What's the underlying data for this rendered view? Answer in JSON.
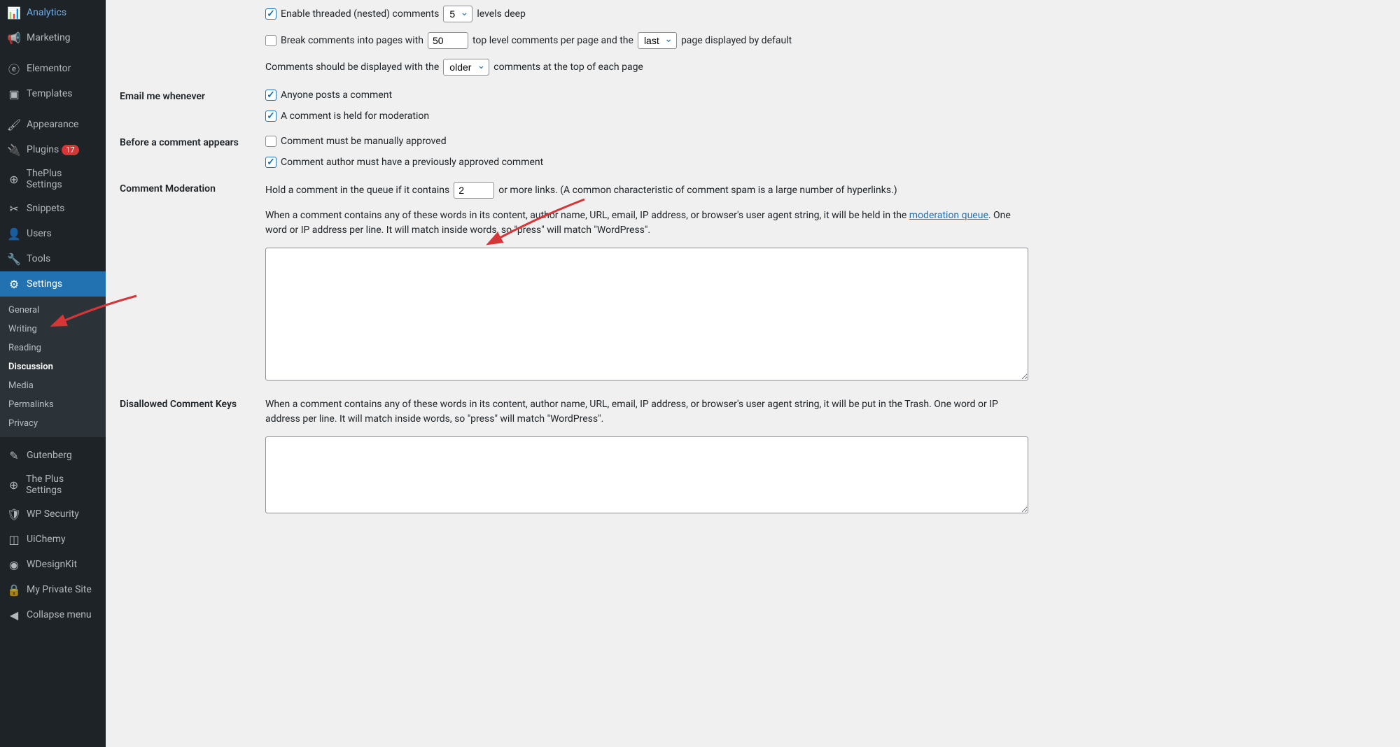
{
  "sidebar": {
    "items": [
      {
        "label": "Analytics",
        "icon": "analytics-icon"
      },
      {
        "label": "Marketing",
        "icon": "marketing-icon"
      },
      {
        "label": "Elementor",
        "icon": "elementor-icon"
      },
      {
        "label": "Templates",
        "icon": "templates-icon"
      },
      {
        "label": "Appearance",
        "icon": "appearance-icon"
      },
      {
        "label": "Plugins",
        "icon": "plugins-icon",
        "badge": "17"
      },
      {
        "label": "ThePlus Settings",
        "icon": "theplus-icon"
      },
      {
        "label": "Snippets",
        "icon": "snippets-icon"
      },
      {
        "label": "Users",
        "icon": "users-icon"
      },
      {
        "label": "Tools",
        "icon": "tools-icon"
      },
      {
        "label": "Settings",
        "icon": "settings-icon",
        "active": true
      },
      {
        "label": "Gutenberg",
        "icon": "gutenberg-icon"
      },
      {
        "label": "The Plus Settings",
        "icon": "theplus2-icon"
      },
      {
        "label": "WP Security",
        "icon": "security-icon"
      },
      {
        "label": "UiChemy",
        "icon": "uichemy-icon"
      },
      {
        "label": "WDesignKit",
        "icon": "wdesignkit-icon"
      },
      {
        "label": "My Private Site",
        "icon": "private-icon"
      },
      {
        "label": "Collapse menu",
        "icon": "collapse-icon"
      }
    ],
    "submenu": [
      {
        "label": "General"
      },
      {
        "label": "Writing"
      },
      {
        "label": "Reading"
      },
      {
        "label": "Discussion",
        "current": true
      },
      {
        "label": "Media"
      },
      {
        "label": "Permalinks"
      },
      {
        "label": "Privacy"
      }
    ]
  },
  "threaded": {
    "label": "Enable threaded (nested) comments",
    "value": "5",
    "suffix": "levels deep"
  },
  "pagination": {
    "label": "Break comments into pages with",
    "value": "50",
    "mid": "top level comments per page and the",
    "select": "last",
    "suffix": "page displayed by default"
  },
  "order": {
    "prefix": "Comments should be displayed with the",
    "value": "older",
    "suffix": "comments at the top of each page"
  },
  "email": {
    "heading": "Email me whenever",
    "opt1": "Anyone posts a comment",
    "opt2": "A comment is held for moderation"
  },
  "before": {
    "heading": "Before a comment appears",
    "opt1": "Comment must be manually approved",
    "opt2": "Comment author must have a previously approved comment"
  },
  "moderation": {
    "heading": "Comment Moderation",
    "prefix": "Hold a comment in the queue if it contains",
    "value": "2",
    "suffix": "or more links. (A common characteristic of comment spam is a large number of hyperlinks.)",
    "desc_prefix": "When a comment contains any of these words in its content, author name, URL, email, IP address, or browser's user agent string, it will be held in the ",
    "link": "moderation queue",
    "desc_suffix": ". One word or IP address per line. It will match inside words, so \"press\" will match \"WordPress\"."
  },
  "disallowed": {
    "heading": "Disallowed Comment Keys",
    "desc": "When a comment contains any of these words in its content, author name, URL, email, IP address, or browser's user agent string, it will be put in the Trash. One word or IP address per line. It will match inside words, so \"press\" will match \"WordPress\"."
  }
}
